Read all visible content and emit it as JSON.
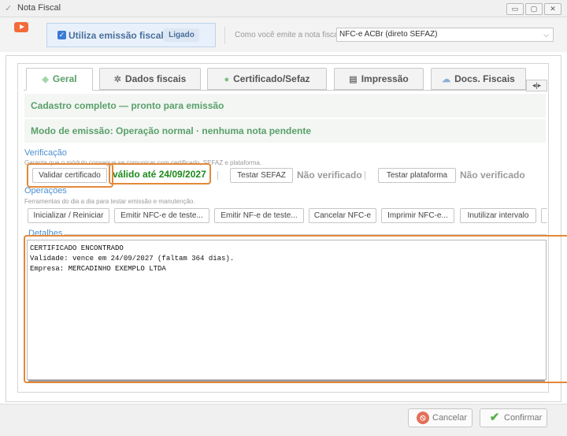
{
  "window": {
    "title": "Nota Fiscal",
    "controls": {
      "minimize": "▭",
      "restore": "▢",
      "close": "✕"
    }
  },
  "header": {
    "emission_toggle_label": "Utiliza emissão fiscal",
    "emission_toggle_checked": true,
    "emission_status_badge": "Ligado",
    "emit_question": "Como você emite a nota fiscal?",
    "emit_method_selected": "NFC-e ACBr (direto SEFAZ)"
  },
  "tabs": [
    {
      "label": "Geral",
      "icon": "gem-icon",
      "active": true
    },
    {
      "label": "Dados fiscais",
      "icon": "gear-icon",
      "active": false
    },
    {
      "label": "Certificado/Sefaz",
      "icon": "check-circle-icon",
      "active": false
    },
    {
      "label": "Impressão",
      "icon": "printer-icon",
      "active": false
    },
    {
      "label": "Docs. Fiscais",
      "icon": "cloud-icon",
      "active": false
    }
  ],
  "tab_nav": "◂|▸",
  "status": {
    "line1": "Cadastro completo — pronto para emissão",
    "line2": "Modo de emissão: Operação normal · nenhuma nota pendente"
  },
  "verificacao": {
    "title": "Verificação",
    "description": "Garanta que o módulo consegue se comunicar com certificado, SEFAZ e plataforma.",
    "validate_cert_button": "Validar certificado",
    "cert_status": "válido até 24/09/2027",
    "test_sefaz_button": "Testar SEFAZ",
    "sefaz_status": "Não verificado",
    "test_platform_button": "Testar plataforma",
    "platform_status": "Não verificado"
  },
  "operacoes": {
    "title": "Operações",
    "description": "Ferramentas do dia a dia para testar emissão e manutenção.",
    "buttons": [
      "Inicializar / Reiniciar",
      "Emitir NFC-e de teste...",
      "Emitir NF-e de teste...",
      "Cancelar NFC-e",
      "Imprimir NFC-e...",
      "Inutilizar intervalo"
    ]
  },
  "detalhes": {
    "title": "Detalhes",
    "lines": [
      "CERTIFICADO ENCONTRADO",
      "Validade: vence em 24/09/2027 (faltam 364 dias).",
      "Empresa: MERCADINHO EXEMPLO LTDA"
    ]
  },
  "footer": {
    "cancel_label": "Cancelar",
    "confirm_label": "Confirmar"
  },
  "colors": {
    "accent_green": "#5aa06a",
    "valid_green": "#1a8a1a",
    "section_blue": "#4d8fcf",
    "highlight_orange": "#e3893a"
  }
}
